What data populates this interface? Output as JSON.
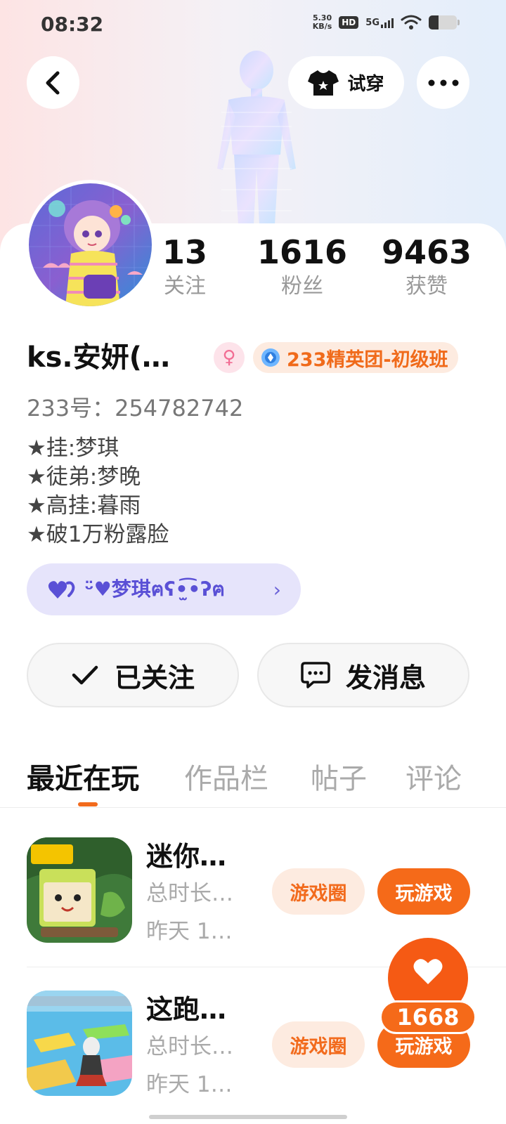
{
  "status_bar": {
    "time": "08:32",
    "net_speed_value": "5.30",
    "net_speed_unit": "KB/s",
    "hd_label": "HD",
    "network": "5G"
  },
  "header": {
    "try_on_label": "试穿"
  },
  "profile": {
    "stats": [
      {
        "value": "13",
        "label": "关注"
      },
      {
        "value": "1616",
        "label": "粉丝"
      },
      {
        "value": "9463",
        "label": "获赞"
      }
    ],
    "name": "ks.安妍(…",
    "gender_icon": "female-icon",
    "level_badge": "233精英团-初级班",
    "id_line": "233号：254782742",
    "bio_lines": [
      "★挂:梦琪",
      "★徒弟:梦晚",
      "★高挂:暮雨",
      "★破1万粉露脸"
    ],
    "cp_text": "ᵕ̈♥梦琪ฅʕ•̫͡•ʔฅ"
  },
  "actions": {
    "follow_label": "已关注",
    "message_label": "发消息"
  },
  "tabs": [
    "最近在玩",
    "作品栏",
    "帖子",
    "评论"
  ],
  "games": [
    {
      "name": "迷你…",
      "duration": "总时长…",
      "last_played": "昨天 1…",
      "circle_label": "游戏圈",
      "play_label": "玩游戏"
    },
    {
      "name": "这跑…",
      "duration": "总时长…",
      "last_played": "昨天 1…",
      "circle_label": "游戏圈",
      "play_label": "玩游戏"
    }
  ],
  "like_count": "1668",
  "colors": {
    "accent": "#f56a19",
    "cp_bg": "#e6e4fb",
    "cp_text": "#5a50d6"
  }
}
